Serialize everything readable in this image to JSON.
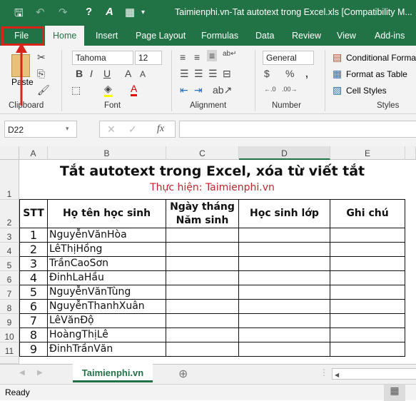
{
  "titlebar": {
    "title": "Taimienphi.vn-Tat autotext trong Excel.xls  [Compatibility M..."
  },
  "tabs": [
    "File",
    "Home",
    "Insert",
    "Page Layout",
    "Formulas",
    "Data",
    "Review",
    "View",
    "Add-ins"
  ],
  "ribbon": {
    "clipboard": {
      "paste": "Paste",
      "label": "Clipboard"
    },
    "font": {
      "name": "Tahoma",
      "size": "12",
      "label": "Font"
    },
    "alignment": {
      "label": "Alignment"
    },
    "number": {
      "format": "General",
      "label": "Number"
    },
    "styles": {
      "conditional": "Conditional Forma",
      "format_table": "Format as Table",
      "cell_styles": "Cell Styles",
      "label": "Styles"
    }
  },
  "formula_bar": {
    "name_box": "D22",
    "formula": "",
    "fx": "fx"
  },
  "columns": [
    "A",
    "B",
    "C",
    "D",
    "E"
  ],
  "sheet": {
    "title": "Tắt autotext trong Excel, xóa từ viết tắt",
    "subtitle": "Thực hiện: Taimienphi.vn",
    "headers": [
      "STT",
      "Họ tên học sinh",
      "Ngày tháng\nNăm sinh",
      "Học sinh lớp",
      "Ghi chú"
    ],
    "rows": [
      [
        "1",
        "NguyễnVănHòa"
      ],
      [
        "2",
        "LêThịHồng"
      ],
      [
        "3",
        "TrầnCaoSơn"
      ],
      [
        "4",
        "ĐinhLaHầu"
      ],
      [
        "5",
        "NguyễnVănTùng"
      ],
      [
        "6",
        "NguyễnThanhXuân"
      ],
      [
        "7",
        "LêVănĐộ"
      ],
      [
        "8",
        "HoàngThịLê"
      ],
      [
        "9",
        "ĐinhTrầnVăn"
      ]
    ],
    "row_numbers": [
      "1",
      "2",
      "3",
      "4",
      "5",
      "6",
      "7",
      "8",
      "9",
      "10",
      "11"
    ]
  },
  "sheet_tabs": [
    "Taimienphi.vn"
  ],
  "status": {
    "text": "Ready"
  },
  "colors": {
    "accent": "#217346",
    "highlight_box": "#d9241c",
    "subtitle": "#c0272d"
  }
}
